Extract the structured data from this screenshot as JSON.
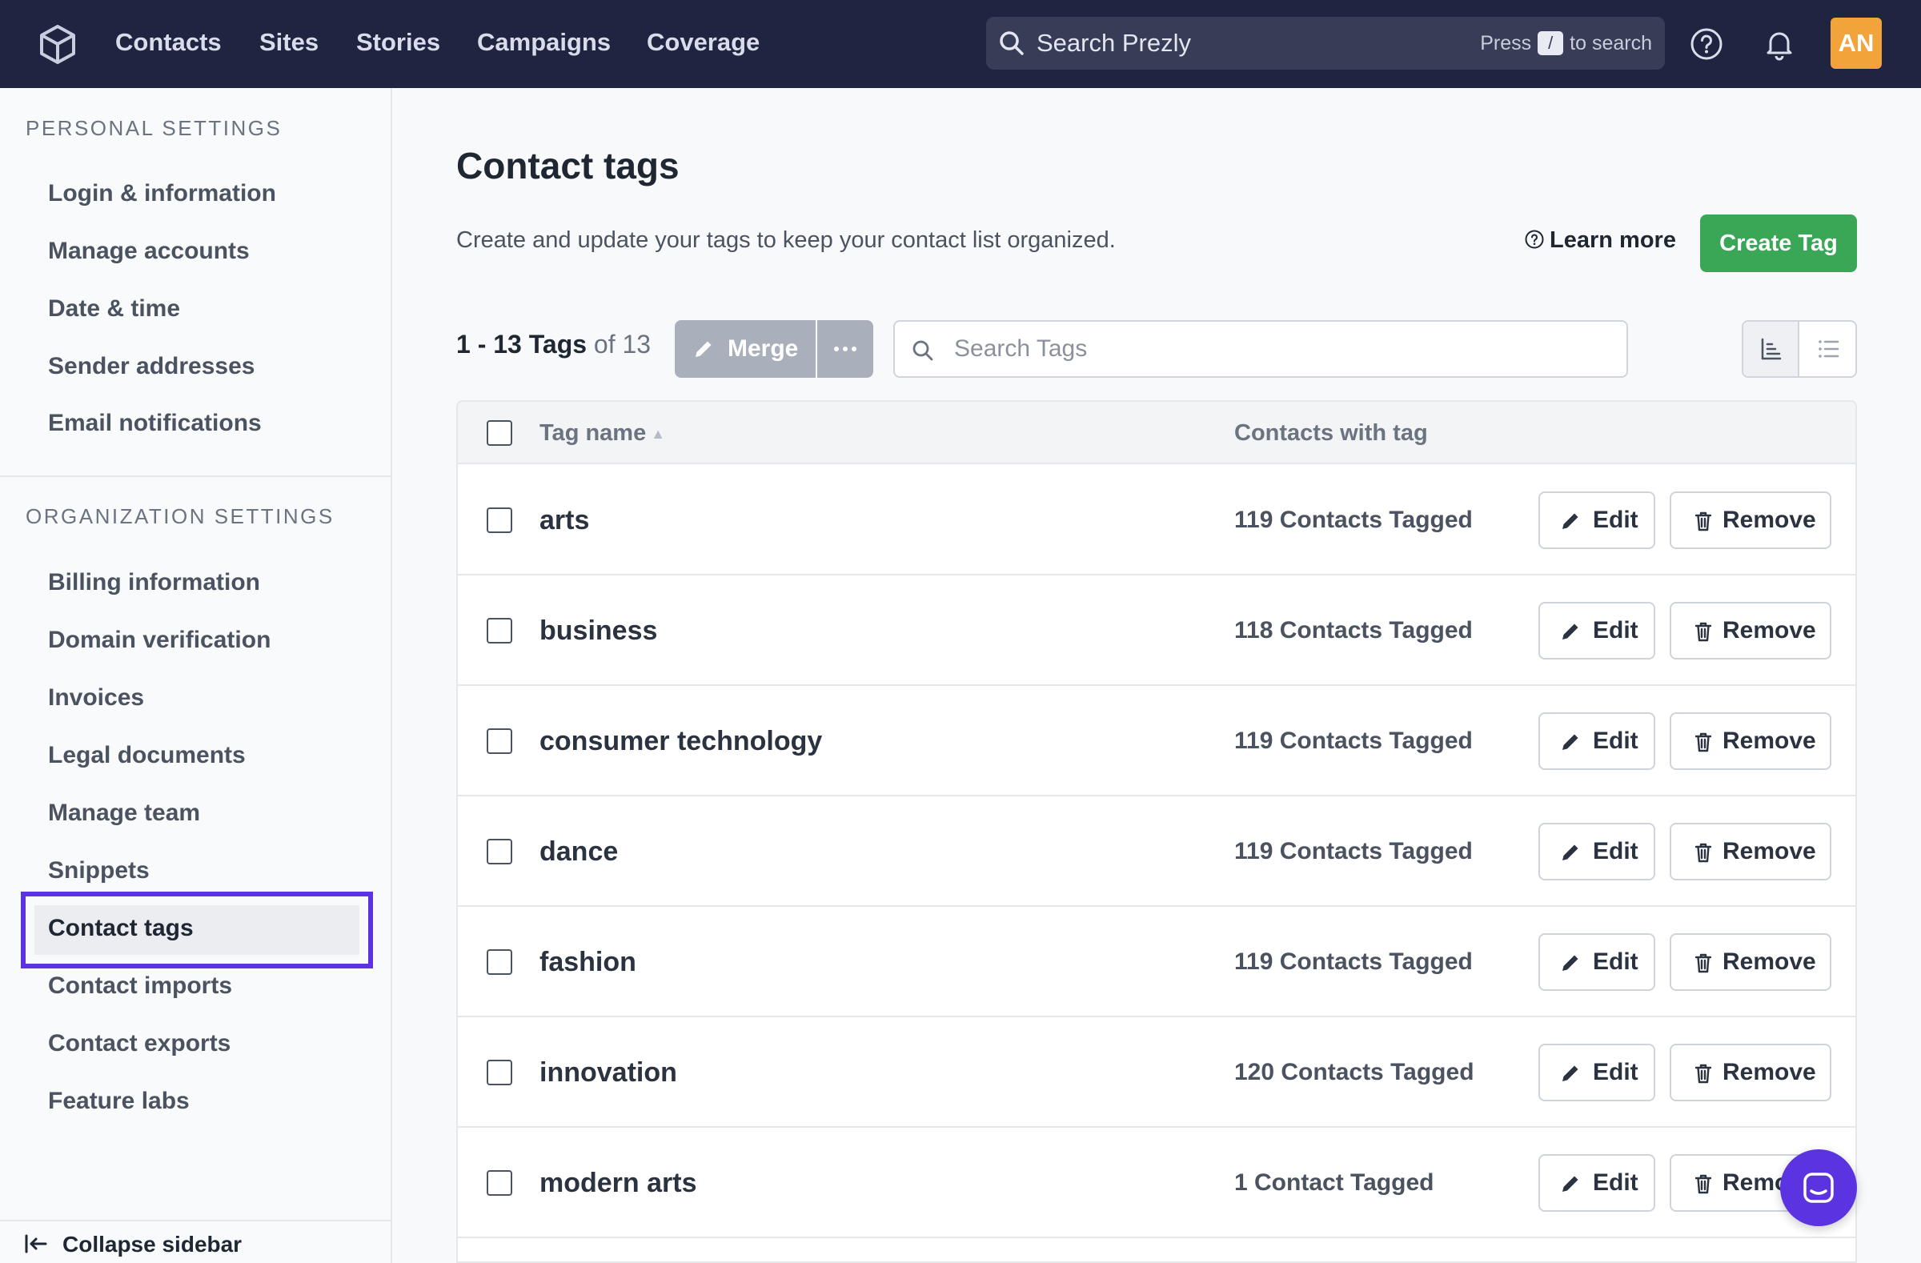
{
  "topnav": {
    "items": [
      "Contacts",
      "Sites",
      "Stories",
      "Campaigns",
      "Coverage"
    ],
    "search": {
      "placeholder": "Search Prezly",
      "hint_press": "Press",
      "hint_key": "/",
      "hint_suffix": "to search"
    },
    "avatar_initials": "AN",
    "icons": [
      "prezly-logo-icon",
      "search-icon",
      "help-icon",
      "bell-icon"
    ]
  },
  "sidebar": {
    "personal_title": "PERSONAL SETTINGS",
    "personal_items": [
      "Login & information",
      "Manage accounts",
      "Date & time",
      "Sender addresses",
      "Email notifications"
    ],
    "org_title": "ORGANIZATION SETTINGS",
    "org_items": [
      "Billing information",
      "Domain verification",
      "Invoices",
      "Legal documents",
      "Manage team",
      "Snippets",
      "Contact tags",
      "Contact imports",
      "Contact exports",
      "Feature labs"
    ],
    "active_item": "Contact tags",
    "collapse_label": "Collapse sidebar"
  },
  "main": {
    "title": "Contact tags",
    "subtitle": "Create and update your tags to keep your contact list organized.",
    "learn_more": "Learn more",
    "create_button": "Create Tag",
    "count_main": "1 - 13 Tags",
    "count_of": "of 13",
    "merge_button": "Merge",
    "search_placeholder": "Search Tags",
    "table": {
      "columns": [
        "Tag name",
        "Contacts with tag"
      ],
      "edit_label": "Edit",
      "remove_label": "Remove",
      "rows": [
        {
          "name": "arts",
          "contacts": "119 Contacts Tagged"
        },
        {
          "name": "business",
          "contacts": "118 Contacts Tagged"
        },
        {
          "name": "consumer technology",
          "contacts": "119 Contacts Tagged"
        },
        {
          "name": "dance",
          "contacts": "119 Contacts Tagged"
        },
        {
          "name": "fashion",
          "contacts": "119 Contacts Tagged"
        },
        {
          "name": "innovation",
          "contacts": "120 Contacts Tagged"
        },
        {
          "name": "modern arts",
          "contacts": "1 Contact Tagged"
        }
      ]
    }
  },
  "colors": {
    "topbar": "#1f2540",
    "create_button": "#3aa757",
    "active_highlight": "#5b33e0",
    "avatar": "#f2a33a",
    "merge_button": "#a9b0bb"
  }
}
